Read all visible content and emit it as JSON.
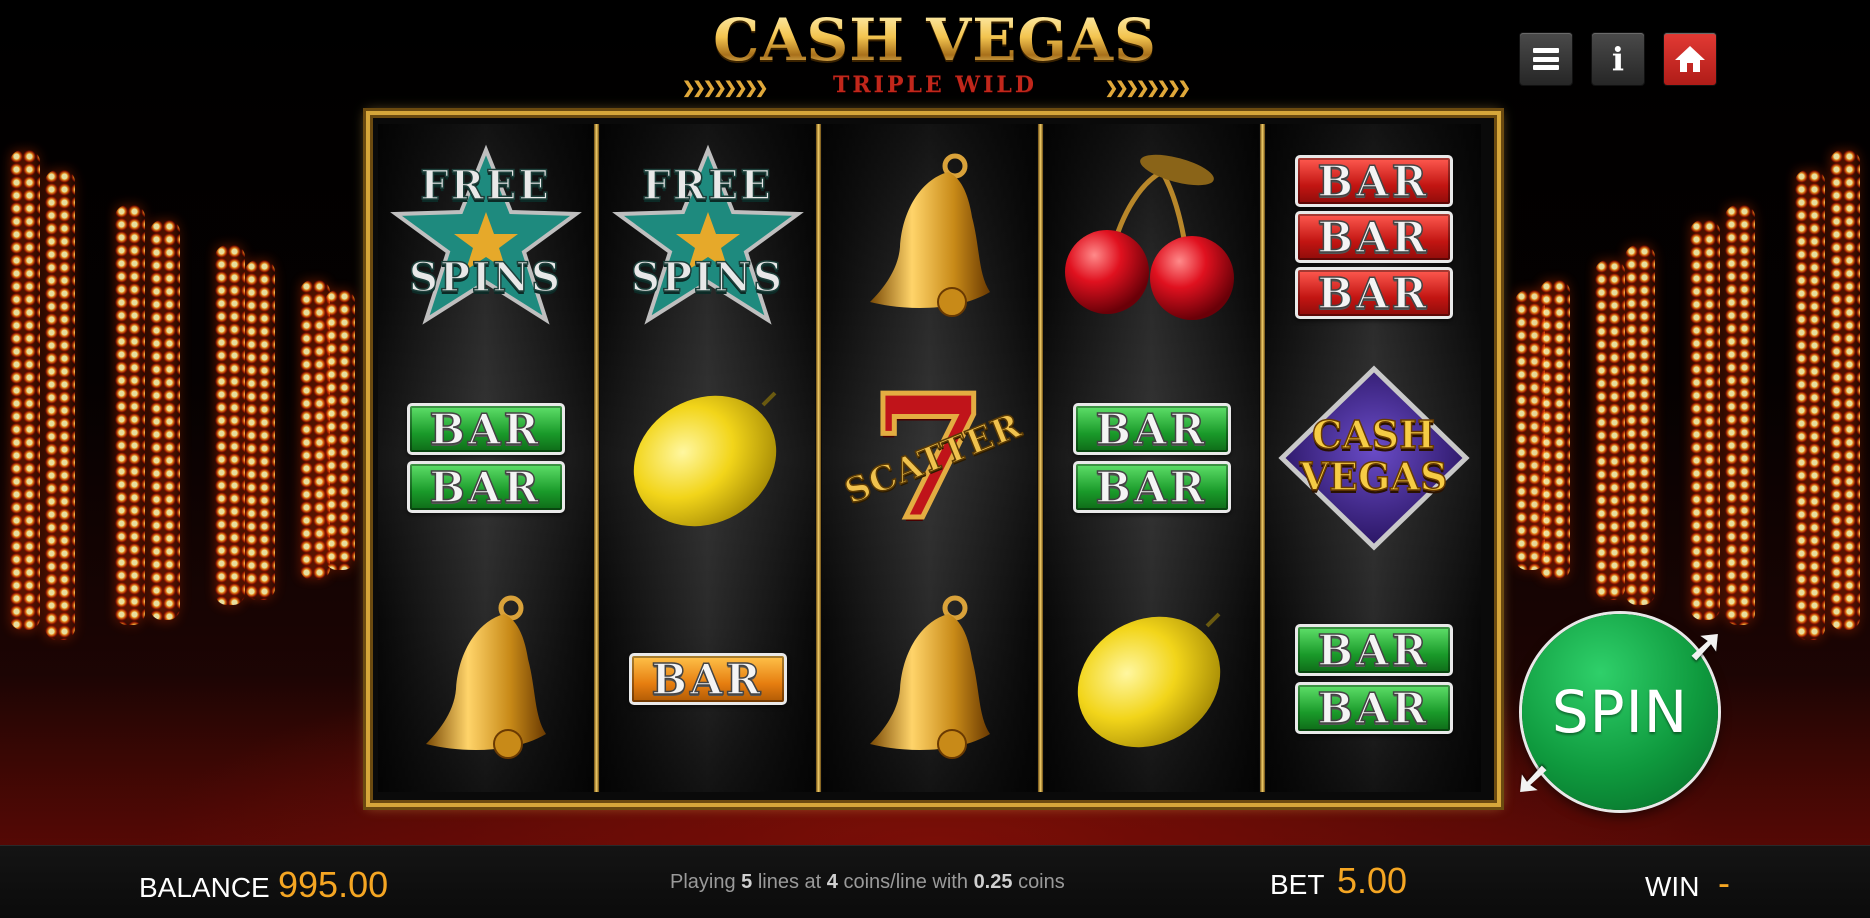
{
  "game": {
    "title": "CASH VEGAS",
    "subtitle": "TRIPLE WILD"
  },
  "top_buttons": [
    {
      "name": "menu",
      "icon": "hamburger-icon"
    },
    {
      "name": "info",
      "icon": "info-icon"
    },
    {
      "name": "home",
      "icon": "home-icon"
    }
  ],
  "reels": [
    [
      "FREE SPINS",
      "BAR BAR (green)",
      "BELL"
    ],
    [
      "FREE SPINS",
      "LEMON",
      "BAR (orange)"
    ],
    [
      "BELL",
      "7 SCATTER",
      "BELL"
    ],
    [
      "CHERRY",
      "BAR BAR (green)",
      "LEMON"
    ],
    [
      "BAR BAR BAR (red)",
      "CASH VEGAS",
      "BAR BAR (green)"
    ]
  ],
  "symbols": {
    "bar": "BAR",
    "free": "FREE",
    "spins": "SPINS",
    "scatter": "SCATTER",
    "seven": "7",
    "cash": "CASH",
    "vegas": "VEGAS"
  },
  "spin_button": {
    "label": "SPIN"
  },
  "footer": {
    "balance_label": "BALANCE",
    "balance_value": "995.00",
    "playing_prefix": "Playing",
    "lines": "5",
    "lines_text": "lines at",
    "coins_per_line": "4",
    "coins_per_line_text": "coins/line with",
    "coin_value": "0.25",
    "coins_text": "coins",
    "bet_label": "BET",
    "bet_value": "5.00",
    "win_label": "WIN",
    "win_value": "-"
  },
  "colors": {
    "accent": "#f5a623",
    "frame_gold": "#d6a63a",
    "spin_green": "#0f9a3e",
    "home_red": "#c9241f"
  }
}
